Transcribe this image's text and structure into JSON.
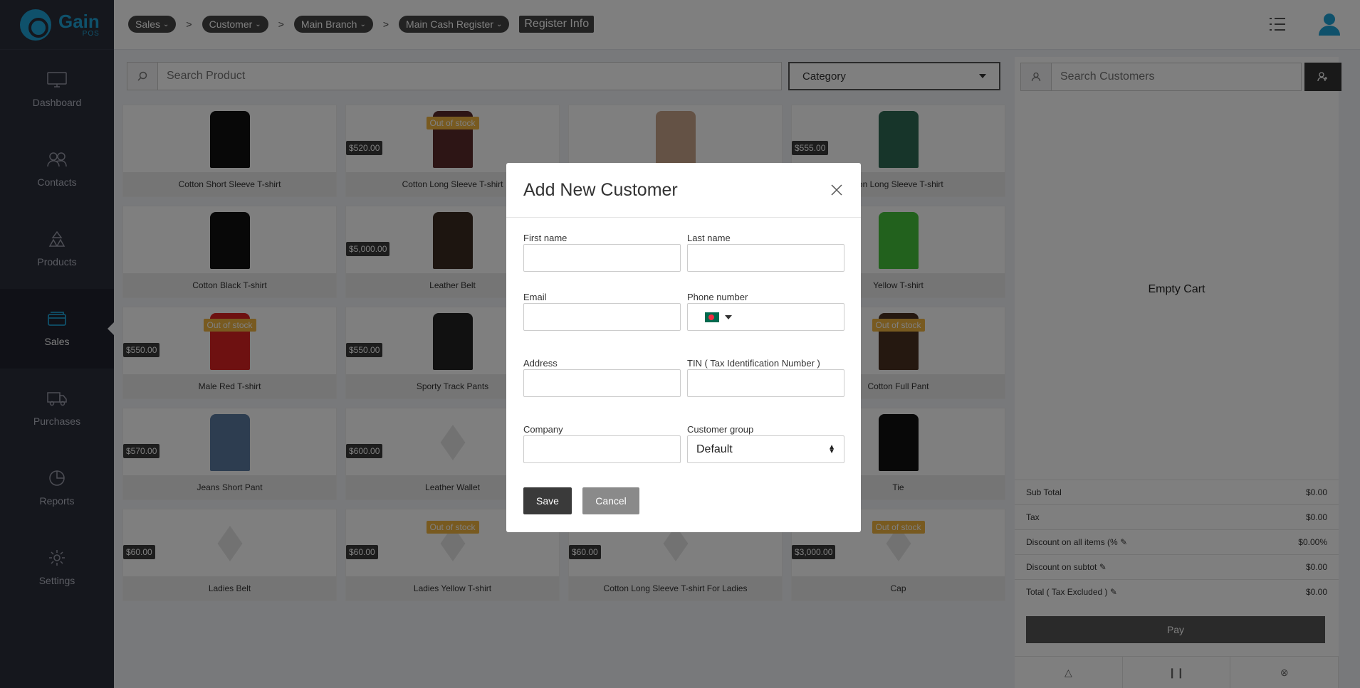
{
  "brand": {
    "name": "Gain",
    "sub": "POS"
  },
  "sidebar": {
    "items": [
      {
        "label": "Dashboard",
        "icon": "monitor-icon"
      },
      {
        "label": "Contacts",
        "icon": "users-icon"
      },
      {
        "label": "Products",
        "icon": "products-icon"
      },
      {
        "label": "Sales",
        "icon": "sales-icon",
        "active": true
      },
      {
        "label": "Purchases",
        "icon": "truck-icon"
      },
      {
        "label": "Reports",
        "icon": "pie-chart-icon"
      },
      {
        "label": "Settings",
        "icon": "gear-icon"
      }
    ]
  },
  "breadcrumb": {
    "items": [
      "Sales",
      "Customer",
      "Main Branch",
      "Main Cash Register"
    ],
    "separator": ">",
    "register_info": "Register Info"
  },
  "search": {
    "placeholder": "Search Product"
  },
  "category": {
    "label": "Category"
  },
  "products": [
    {
      "name": "Cotton Short Sleeve T-shirt",
      "price": "",
      "out_of_stock": false
    },
    {
      "name": "Cotton Long Sleeve T-shirt",
      "price": "$520.00",
      "out_of_stock": true
    },
    {
      "name": "",
      "price": "",
      "out_of_stock": false
    },
    {
      "name": "tton Long Sleeve T-shirt",
      "price": "$555.00",
      "out_of_stock": false
    },
    {
      "name": "Cotton Black T-shirt",
      "price": "",
      "out_of_stock": false
    },
    {
      "name": "Leather Belt",
      "price": "$5,000.00",
      "out_of_stock": false
    },
    {
      "name": "",
      "price": "",
      "out_of_stock": false
    },
    {
      "name": "Yellow T-shirt",
      "price": "",
      "out_of_stock": false
    },
    {
      "name": "Male Red T-shirt",
      "price": "$550.00",
      "out_of_stock": true
    },
    {
      "name": "Sporty Track Pants",
      "price": "$550.00",
      "out_of_stock": false
    },
    {
      "name": "",
      "price": "",
      "out_of_stock": false
    },
    {
      "name": "Cotton Full Pant",
      "price": "",
      "out_of_stock": true
    },
    {
      "name": "Jeans Short Pant",
      "price": "$570.00",
      "out_of_stock": false
    },
    {
      "name": "Leather Wallet",
      "price": "$600.00",
      "out_of_stock": false
    },
    {
      "name": "",
      "price": "",
      "out_of_stock": false
    },
    {
      "name": "Tie",
      "price": "",
      "out_of_stock": false
    },
    {
      "name": "Ladies Belt",
      "price": "$60.00",
      "out_of_stock": false
    },
    {
      "name": "Ladies Yellow T-shirt",
      "price": "$60.00",
      "out_of_stock": true
    },
    {
      "name": "Cotton Long Sleeve T-shirt For Ladies",
      "price": "$60.00",
      "out_of_stock": false
    },
    {
      "name": "Cap",
      "price": "$3,000.00",
      "out_of_stock": true
    }
  ],
  "labels": {
    "out_of_stock": "Out of stock"
  },
  "cart": {
    "search_placeholder": "Search Customers",
    "empty": "Empty Cart",
    "rows": [
      {
        "label": "Sub Total",
        "value": "$0.00"
      },
      {
        "label": "Tax",
        "value": "$0.00"
      },
      {
        "label": "Discount on all items (%",
        "value": "$0.00%"
      },
      {
        "label": "Discount on subtot",
        "value": "$0.00"
      },
      {
        "label": "Total ( Tax Excluded )",
        "value": "$0.00"
      }
    ],
    "pay": "Pay"
  },
  "modal": {
    "title": "Add New Customer",
    "first_name": "First name",
    "last_name": "Last name",
    "email": "Email",
    "phone": "Phone number",
    "address": "Address",
    "tin": "TIN ( Tax Identification Number )",
    "company": "Company",
    "customer_group": "Customer group",
    "customer_group_value": "Default",
    "save": "Save",
    "cancel": "Cancel"
  },
  "colors": {
    "brand": "#1fa3d6",
    "sidebar": "#2b2e3b",
    "oos_badge": "#f0b541",
    "price_badge": "#3a3a3a"
  }
}
